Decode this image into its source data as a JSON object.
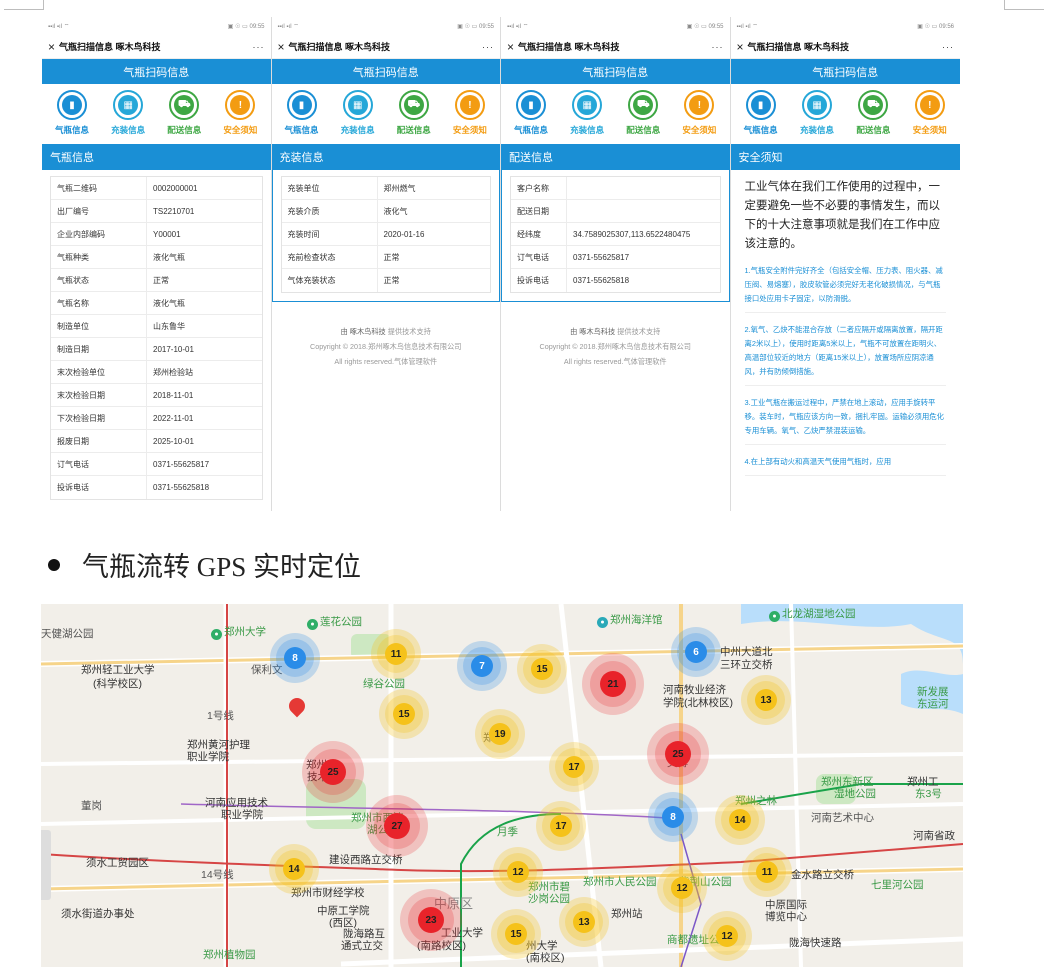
{
  "phones": [
    {
      "status_left": "▪▪ıl ▪ıl ⌔",
      "status_right": "▣ ☉ ▭ 09:55",
      "wx_close": "×",
      "wx_title": "气瓶扫描信息 啄木鸟科技",
      "wx_more": "···",
      "app_title": "气瓶扫码信息",
      "section": "气瓶信息",
      "rows": [
        {
          "k": "气瓶二维码",
          "v": "0002000001"
        },
        {
          "k": "出厂编号",
          "v": "TS2210701"
        },
        {
          "k": "企业内部编码",
          "v": "Y00001"
        },
        {
          "k": "气瓶种类",
          "v": "液化气瓶"
        },
        {
          "k": "气瓶状态",
          "v": "正常"
        },
        {
          "k": "气瓶名称",
          "v": "液化气瓶"
        },
        {
          "k": "制造单位",
          "v": "山东鲁华"
        },
        {
          "k": "制造日期",
          "v": "2017-10-01"
        },
        {
          "k": "末次检验单位",
          "v": "郑州检验站"
        },
        {
          "k": "末次检验日期",
          "v": "2018-11-01"
        },
        {
          "k": "下次检验日期",
          "v": "2022-11-01"
        },
        {
          "k": "报废日期",
          "v": "2025-10-01"
        },
        {
          "k": "订气电话",
          "v": "0371-55625817"
        },
        {
          "k": "投诉电话",
          "v": "0371-55625818"
        }
      ]
    },
    {
      "status_left": "▪▪ıl ▪ıl ⌔",
      "status_right": "▣ ☉ ▭ 09:55",
      "wx_close": "×",
      "wx_title": "气瓶扫描信息 啄木鸟科技",
      "wx_more": "···",
      "app_title": "气瓶扫码信息",
      "section": "充装信息",
      "rows": [
        {
          "k": "充装单位",
          "v": "郑州燃气"
        },
        {
          "k": "充装介质",
          "v": "液化气"
        },
        {
          "k": "充装时间",
          "v": "2020-01-16"
        },
        {
          "k": "充前检查状态",
          "v": "正常"
        },
        {
          "k": "气体充装状态",
          "v": "正常"
        }
      ]
    },
    {
      "status_left": "▪▪ıl ▪ıl ⌔",
      "status_right": "▣ ☉ ▭ 09:55",
      "wx_close": "×",
      "wx_title": "气瓶扫描信息 啄木鸟科技",
      "wx_more": "···",
      "app_title": "气瓶扫码信息",
      "section": "配送信息",
      "rows": [
        {
          "k": "客户名称",
          "v": ""
        },
        {
          "k": "配送日期",
          "v": ""
        },
        {
          "k": "经纬度",
          "v": "34.7589025307,113.6522480475"
        },
        {
          "k": "订气电话",
          "v": "0371-55625817"
        },
        {
          "k": "投诉电话",
          "v": "0371-55625818"
        }
      ]
    },
    {
      "status_left": "▪▪ıl ▪ıl ⌔",
      "status_right": "▣ ☉ ▭ 09:56",
      "wx_close": "×",
      "wx_title": "气瓶扫描信息 啄木鸟科技",
      "wx_more": "···",
      "app_title": "气瓶扫码信息",
      "section": "安全须知",
      "lead": "工业气体在我们工作使用的过程中，一定要避免一些不必要的事情发生，而以下的十大注意事项就是我们在工作中应该注意的。",
      "items": [
        "1.气瓶安全附件完好齐全（包括安全帽、压力表、阻火器、减压阀、易熔塞），胶皮软管必须完好无老化破损情况，与气瓶接口处应用卡子固定，以防滑脱。",
        "2.氧气、乙炔不能混合存放（二者应隔开或隔离放置，隔开距离2米以上），使用时距离5米以上，气瓶不可放置在距明火、高温部位较近的地方（距离15米以上），放置场所应阴凉通风，并有防倾倒措施。",
        "3.工业气瓶在搬运过程中，严禁在地上滚动，应用手旋转平移。装车时，气瓶应该方向一致，捆扎牢固。运输必须用危化专用车辆。氧气、乙炔严禁混装运输。",
        "4.在上部有动火和高温天气使用气瓶时，应用"
      ]
    }
  ],
  "tabs": [
    {
      "label": "气瓶信息",
      "icon": "cylinder-icon",
      "glyph": "▮",
      "color": "#1a8fd5"
    },
    {
      "label": "充装信息",
      "icon": "filling-icon",
      "glyph": "▦",
      "color": "#25a7d8"
    },
    {
      "label": "配送信息",
      "icon": "truck-icon",
      "glyph": "⛟",
      "color": "#3ea744"
    },
    {
      "label": "安全须知",
      "icon": "shield-icon",
      "glyph": "!",
      "color": "#f39c12"
    }
  ],
  "footer": {
    "line1_brand": "由 啄木鸟科技",
    "line1_rest": " 提供技术支持",
    "line2": "Copyright © 2018.郑州啄木鸟信息技术有限公司",
    "line3": "All rights reserved.气体管理软件"
  },
  "heading": "气瓶流转 GPS 实时定位",
  "map": {
    "pois": [
      {
        "text": "郑州大学",
        "icon": "marker-icon"
      },
      {
        "text": "莲花公园",
        "icon": "park-icon"
      },
      {
        "text": "郑州海洋馆",
        "icon": "aquarium-icon"
      },
      {
        "text": "北龙湖湿地公园",
        "icon": "park-icon"
      },
      {
        "text": "天健湖公园"
      },
      {
        "text": "郑州轻工业大学"
      },
      {
        "text": "(科学校区)"
      },
      {
        "text": "保利文"
      },
      {
        "text": "绿谷公园"
      },
      {
        "text": "中州大道北"
      },
      {
        "text": "三环立交桥"
      },
      {
        "text": "河南牧业经济"
      },
      {
        "text": "学院(北林校区)"
      },
      {
        "text": "新发展"
      },
      {
        "text": "东运河"
      },
      {
        "text": "1号线"
      },
      {
        "text": "郑州黄河护理"
      },
      {
        "text": "职业学院"
      },
      {
        "text": "文博"
      },
      {
        "text": "郑州东新区"
      },
      {
        "text": "湿地公园"
      },
      {
        "text": "郑州之林"
      },
      {
        "text": "河南应用技术"
      },
      {
        "text": "职业学院"
      },
      {
        "text": "郑州市西流"
      },
      {
        "text": "湖公园"
      },
      {
        "text": "河南艺术中心"
      },
      {
        "text": "河南省政"
      },
      {
        "text": "须水工贸园区"
      },
      {
        "text": "建设西路立交桥"
      },
      {
        "text": "金水路立交桥"
      },
      {
        "text": "14号线"
      },
      {
        "text": "郑州市财经学校"
      },
      {
        "text": "郑州市人民公园"
      },
      {
        "text": "紫荆山公园"
      },
      {
        "text": "七里河公园"
      },
      {
        "text": "须水街道办事处"
      },
      {
        "text": "中原工学院"
      },
      {
        "text": "(西区)"
      },
      {
        "text": "中原区"
      },
      {
        "text": "郑州站"
      },
      {
        "text": "郑州市碧"
      },
      {
        "text": "沙岗公园"
      },
      {
        "text": "中原国际"
      },
      {
        "text": "博览中心"
      },
      {
        "text": "郑州植物园"
      },
      {
        "text": "陇海路互"
      },
      {
        "text": "通式立交"
      },
      {
        "text": "工业大学"
      },
      {
        "text": "(南路校区)"
      },
      {
        "text": "州大学"
      },
      {
        "text": "(南校区)"
      },
      {
        "text": "商都遗址公园"
      },
      {
        "text": "陇海快速路"
      },
      {
        "text": "董岗"
      },
      {
        "text": "月季"
      },
      {
        "text": "郑州"
      },
      {
        "text": "郑州工"
      },
      {
        "text": "东3号"
      },
      {
        "text": "郑州"
      },
      {
        "text": "技术"
      }
    ],
    "clusters": [
      {
        "count": "8",
        "color": "blue"
      },
      {
        "count": "11",
        "color": "yellow"
      },
      {
        "count": "7",
        "color": "blue"
      },
      {
        "count": "15",
        "color": "yellow"
      },
      {
        "count": "21",
        "color": "red"
      },
      {
        "count": "6",
        "color": "blue"
      },
      {
        "count": "13",
        "color": "yellow"
      },
      {
        "count": "15",
        "color": "yellow"
      },
      {
        "count": "19",
        "color": "yellow"
      },
      {
        "count": "25",
        "color": "red"
      },
      {
        "count": "25",
        "color": "red"
      },
      {
        "count": "17",
        "color": "yellow"
      },
      {
        "count": "27",
        "color": "red"
      },
      {
        "count": "17",
        "color": "yellow"
      },
      {
        "count": "8",
        "color": "blue"
      },
      {
        "count": "14",
        "color": "yellow"
      },
      {
        "count": "14",
        "color": "yellow"
      },
      {
        "count": "12",
        "color": "yellow"
      },
      {
        "count": "12",
        "color": "yellow"
      },
      {
        "count": "11",
        "color": "yellow"
      },
      {
        "count": "23",
        "color": "red"
      },
      {
        "count": "13",
        "color": "yellow"
      },
      {
        "count": "15",
        "color": "yellow"
      },
      {
        "count": "12",
        "color": "yellow"
      }
    ]
  }
}
